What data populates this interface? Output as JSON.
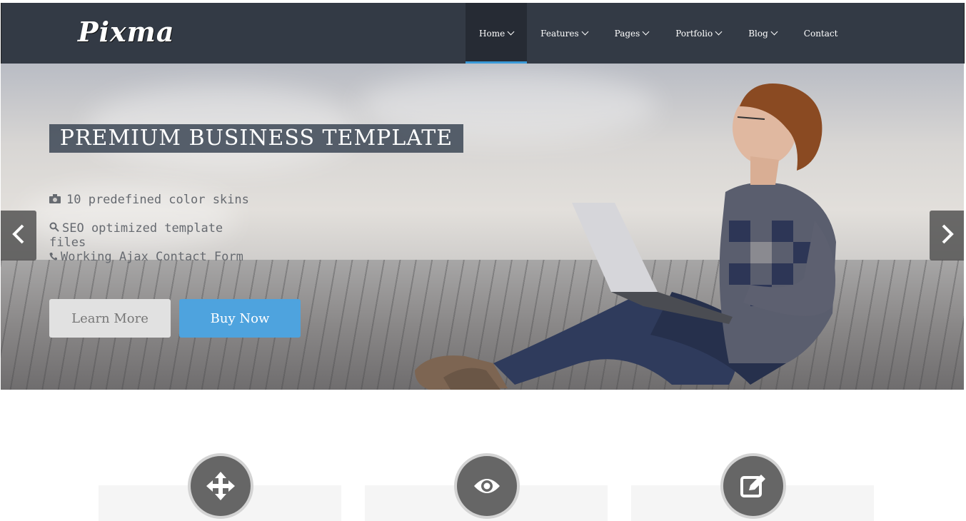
{
  "brand": {
    "logo": "Pixma"
  },
  "nav": {
    "items": [
      {
        "label": "Home",
        "dropdown": true,
        "active": true
      },
      {
        "label": "Features",
        "dropdown": true
      },
      {
        "label": "Pages",
        "dropdown": true
      },
      {
        "label": "Portfolio",
        "dropdown": true
      },
      {
        "label": "Blog",
        "dropdown": true
      },
      {
        "label": "Contact",
        "dropdown": false
      }
    ]
  },
  "hero": {
    "title": "PREMIUM BUSINESS TEMPLATE",
    "features": [
      {
        "icon": "camera-icon",
        "text": "10 predefined color skins"
      },
      {
        "icon": "search-icon",
        "text": "SEO optimized template files"
      },
      {
        "icon": "phone-icon",
        "text": "Working Ajax Contact Form"
      }
    ],
    "learn_more": "Learn More",
    "buy_now": "Buy Now"
  },
  "services": [
    {
      "icon": "move-arrows-icon"
    },
    {
      "icon": "eye-icon"
    },
    {
      "icon": "edit-icon"
    }
  ],
  "colors": {
    "nav_bg": "#333a45",
    "accent": "#3a99d8",
    "buy_button": "#4ea3de"
  }
}
